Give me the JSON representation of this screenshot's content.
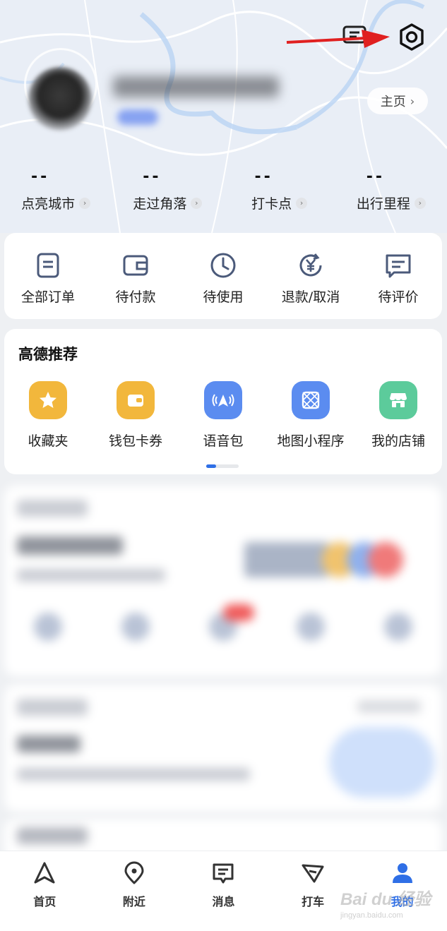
{
  "header": {
    "message_icon": "message-icon",
    "settings_icon": "gear-icon"
  },
  "profile": {
    "home_label": "主页",
    "stats": [
      {
        "value": "--",
        "label": "点亮城市"
      },
      {
        "value": "--",
        "label": "走过角落"
      },
      {
        "value": "--",
        "label": "打卡点"
      },
      {
        "value": "--",
        "label": "出行里程"
      }
    ]
  },
  "orders": {
    "items": [
      {
        "label": "全部订单",
        "icon": "order-list-icon"
      },
      {
        "label": "待付款",
        "icon": "wallet-icon"
      },
      {
        "label": "待使用",
        "icon": "clock-icon"
      },
      {
        "label": "退款/取消",
        "icon": "refund-icon"
      },
      {
        "label": "待评价",
        "icon": "comment-icon"
      }
    ]
  },
  "recommend": {
    "title": "高德推荐",
    "items": [
      {
        "label": "收藏夹",
        "icon": "star-icon",
        "color": "#f2b73c"
      },
      {
        "label": "钱包卡券",
        "icon": "wallet-card-icon",
        "color": "#f2b73c"
      },
      {
        "label": "语音包",
        "icon": "voice-icon",
        "color": "#5b8cf0"
      },
      {
        "label": "地图小程序",
        "icon": "mini-program-icon",
        "color": "#5b8cf0"
      },
      {
        "label": "我的店铺",
        "icon": "store-icon",
        "color": "#5ccb9b"
      }
    ]
  },
  "bottom_nav": {
    "items": [
      {
        "label": "首页",
        "icon": "navigation-arrow-icon"
      },
      {
        "label": "附近",
        "icon": "location-pin-icon"
      },
      {
        "label": "消息",
        "icon": "message-icon"
      },
      {
        "label": "打车",
        "icon": "taxi-icon"
      },
      {
        "label": "我的",
        "icon": "user-icon",
        "active": true
      }
    ]
  },
  "colors": {
    "accent": "#2f6fe6",
    "annotation_arrow": "#e02020"
  },
  "watermark": {
    "logo": "Bai du 经验",
    "url": "jingyan.baidu.com"
  }
}
